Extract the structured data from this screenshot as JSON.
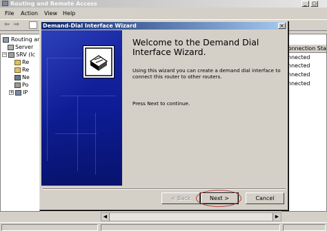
{
  "window": {
    "title": "Routing and Remote Access",
    "minimize": "_",
    "maximize": "□"
  },
  "menu": [
    {
      "label": "File"
    },
    {
      "label": "Action"
    },
    {
      "label": "View"
    },
    {
      "label": "Help"
    }
  ],
  "tree": [
    {
      "label": "Routing an",
      "icon": "computer-icon"
    },
    {
      "label": "Server",
      "icon": "server-icon"
    },
    {
      "label": "SRV (lc",
      "icon": "server-icon"
    },
    {
      "label": "Re",
      "icon": "folder-icon"
    },
    {
      "label": "Re",
      "icon": "folder-icon"
    },
    {
      "label": "Ne",
      "icon": "network-interfaces-icon"
    },
    {
      "label": "Po",
      "icon": "ports-icon"
    },
    {
      "label": "IP",
      "icon": "ip-routing-icon"
    }
  ],
  "list": {
    "column_header": "Connection State",
    "rows": [
      "onnected",
      "onnected",
      "onnected",
      "onnected"
    ]
  },
  "dialog": {
    "title": "Demand-Dial Interface Wizard",
    "close": "×",
    "heading": "Welcome to the Demand Dial Interface Wizard.",
    "body1": "Using this wizard you can create a demand dial interface to connect this router to other routers.",
    "body2": "Press Next to continue.",
    "buttons": {
      "back": "< Back",
      "next": "Next >",
      "cancel": "Cancel"
    }
  },
  "colors": {
    "title_active": "#0a246a",
    "banner": "#0b1a8c",
    "annotation_circle": "#b43c3c"
  }
}
